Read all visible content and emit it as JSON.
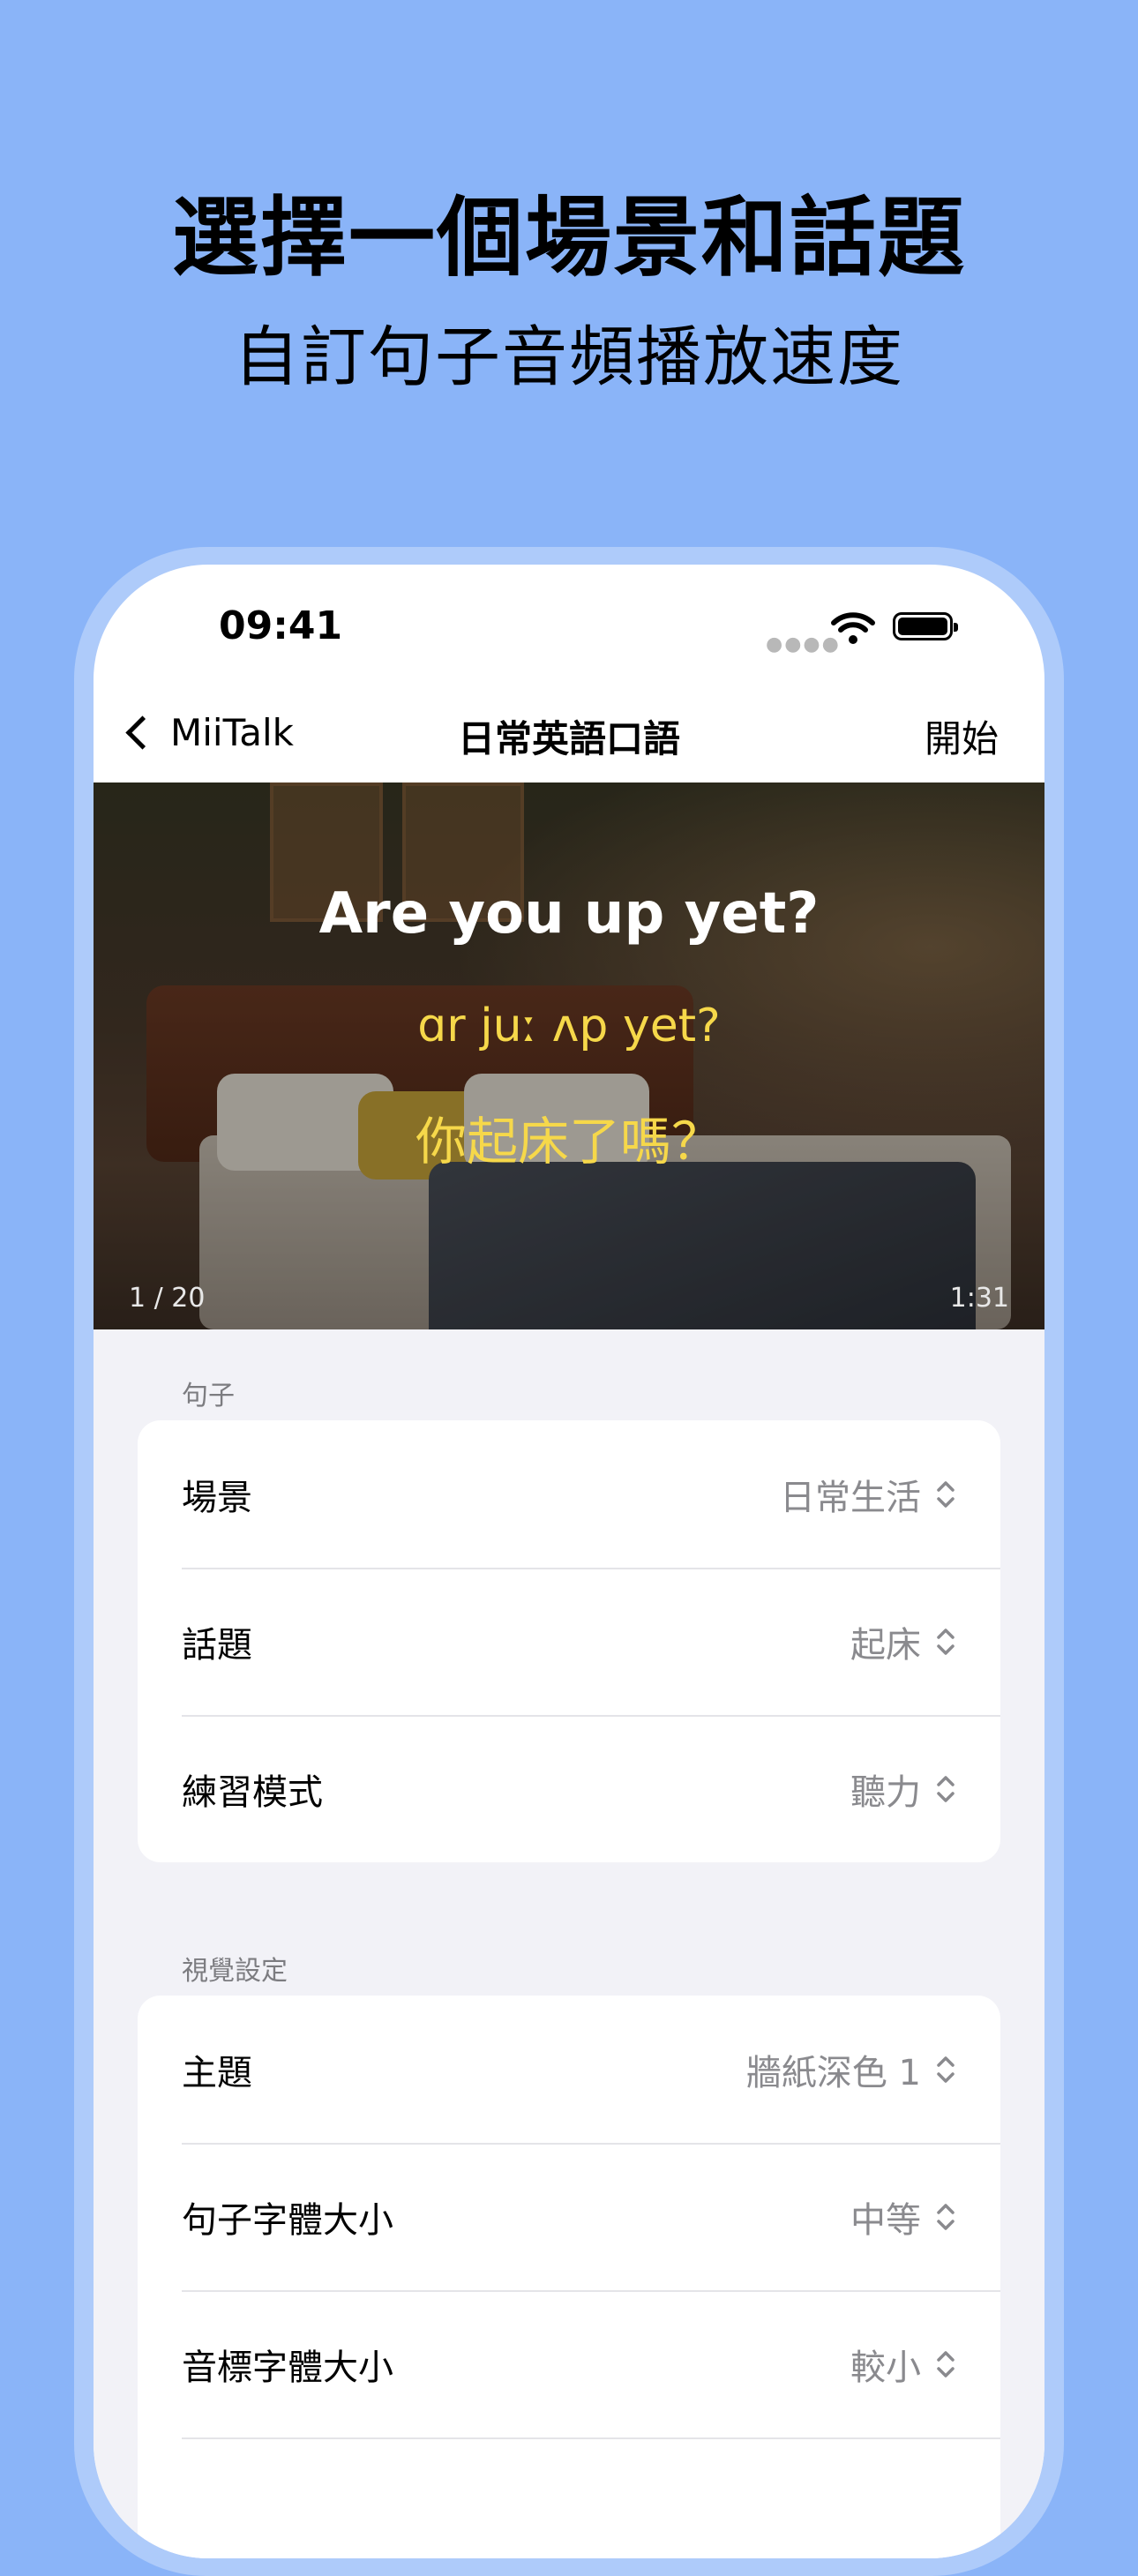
{
  "promo": {
    "headline": "選擇一個場景和話題",
    "subheadline": "自訂句子音頻播放速度"
  },
  "status_bar": {
    "time": "09:41",
    "icons": [
      "signal-dots-icon",
      "wifi-icon",
      "battery-icon"
    ]
  },
  "nav": {
    "back_label": "MiiTalk",
    "title": "日常英語口語",
    "action_label": "開始"
  },
  "hero": {
    "sentence": "Are you up yet?",
    "phonetic": "ɑr juː ʌp yet?",
    "translation": "你起床了嗎？",
    "counter": "1 / 20",
    "duration": "1:31"
  },
  "sections": [
    {
      "header": "句子",
      "rows": [
        {
          "label": "場景",
          "value": "日常生活"
        },
        {
          "label": "話題",
          "value": "起床"
        },
        {
          "label": "練習模式",
          "value": "聽力"
        }
      ]
    },
    {
      "header": "視覺設定",
      "rows": [
        {
          "label": "主題",
          "value": "牆紙深色 1"
        },
        {
          "label": "句子字體大小",
          "value": "中等"
        },
        {
          "label": "音標字體大小",
          "value": "較小"
        }
      ]
    }
  ]
}
